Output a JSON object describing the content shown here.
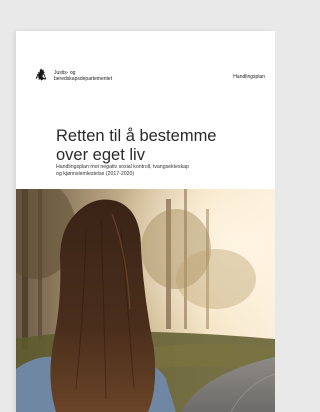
{
  "header": {
    "department_line1": "Justis- og",
    "department_line2": "beredskapsdepartementet",
    "doc_type": "Handlingsplan",
    "logo_icon": "norwegian-lion-crest-icon"
  },
  "cover": {
    "title_line1": "Retten til å bestemme",
    "title_line2": "over eget liv",
    "subtitle_line1": "Handlingsplan mot negativ sosial kontroll, tvangsekteskap",
    "subtitle_line2": "og kjønnslemlestelse (2017-2020)"
  },
  "colors": {
    "page_background": "#ffffff",
    "text": "#2a2a2a"
  }
}
